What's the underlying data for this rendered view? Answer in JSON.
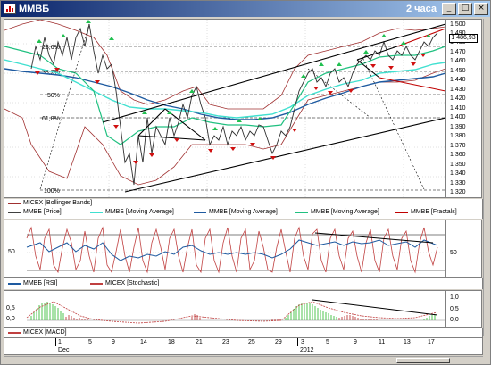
{
  "window": {
    "title": "MMBБ",
    "period": "2 часа",
    "buttons": [
      "_",
      "□",
      "×"
    ]
  },
  "price_chart": {
    "y_ticks": [
      "1 500",
      "1 490",
      "1 480",
      "1 470",
      "1 460",
      "1 450",
      "1 440",
      "1 430",
      "1 420",
      "1 410",
      "1 400",
      "1 390",
      "1 380",
      "1 370",
      "1 360",
      "1 350",
      "1 340",
      "1 330",
      "1 320"
    ],
    "current_price": "1 486,93",
    "fib_labels": [
      "23,6%",
      "38,2%",
      "50%",
      "61,8%",
      "100%"
    ],
    "legend": [
      {
        "label": "MICEX [Bollinger Bands]",
        "color": "#a03030"
      },
      {
        "label": "MMBБ [Price]",
        "color": "#404040"
      },
      {
        "label": "MMBБ [Moving Average]",
        "color": "#40e0d0"
      },
      {
        "label": "MMBБ [Moving Average]",
        "color": "#1e5aa0"
      },
      {
        "label": "MMBБ [Moving Average]",
        "color": "#20c080"
      },
      {
        "label": "MMBБ [Fractals]",
        "color": "#c00000"
      }
    ]
  },
  "oscillator": {
    "y_tick": "50",
    "y_tick_right": "50",
    "legend": [
      {
        "label": "MMBБ [RSI]",
        "color": "#1e5aa0"
      },
      {
        "label": "MICEX [Stochastic]",
        "color": "#c04040"
      }
    ]
  },
  "macd": {
    "y_ticks_left": [
      "0,5",
      "0,0"
    ],
    "y_ticks_right": [
      "1,0",
      "0,5",
      "0,0"
    ],
    "legend": [
      {
        "label": "MICEX [MACD]",
        "color": "#c04040"
      }
    ]
  },
  "time_axis": {
    "days": [
      "1",
      "5",
      "9",
      "14",
      "18",
      "21",
      "23",
      "25",
      "29",
      "3",
      "5",
      "9",
      "11",
      "13",
      "17"
    ],
    "months": [
      "Dec",
      "2012"
    ]
  }
}
